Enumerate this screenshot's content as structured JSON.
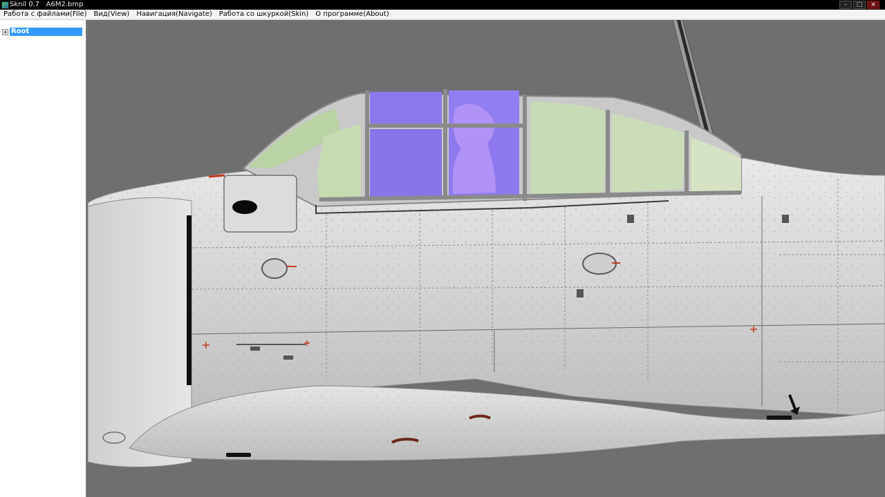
{
  "window": {
    "title": "Sknil 0.7   A6M2.bmp",
    "controls": {
      "minimize": "–",
      "maximize": "□",
      "close": "×"
    }
  },
  "menu": {
    "items": [
      {
        "label": "Работа с файлами(File)"
      },
      {
        "label": "Вид(View)"
      },
      {
        "label": "Навигация(Navigate)"
      },
      {
        "label": "Работа со шкуркой(Skin)"
      },
      {
        "label": "О программе(About)"
      }
    ]
  },
  "tree": {
    "root_label": "Root",
    "expander_icon": "plus-box-icon"
  },
  "viewport": {
    "subject": "A6M2 fuselage texture render",
    "colors": {
      "background": "#6f6f6f",
      "skin": "#d9d9d9",
      "canopy_green": "#b7d3a0",
      "canopy_purple": "#8a72e8",
      "marking_red": "#c23a1c"
    }
  }
}
